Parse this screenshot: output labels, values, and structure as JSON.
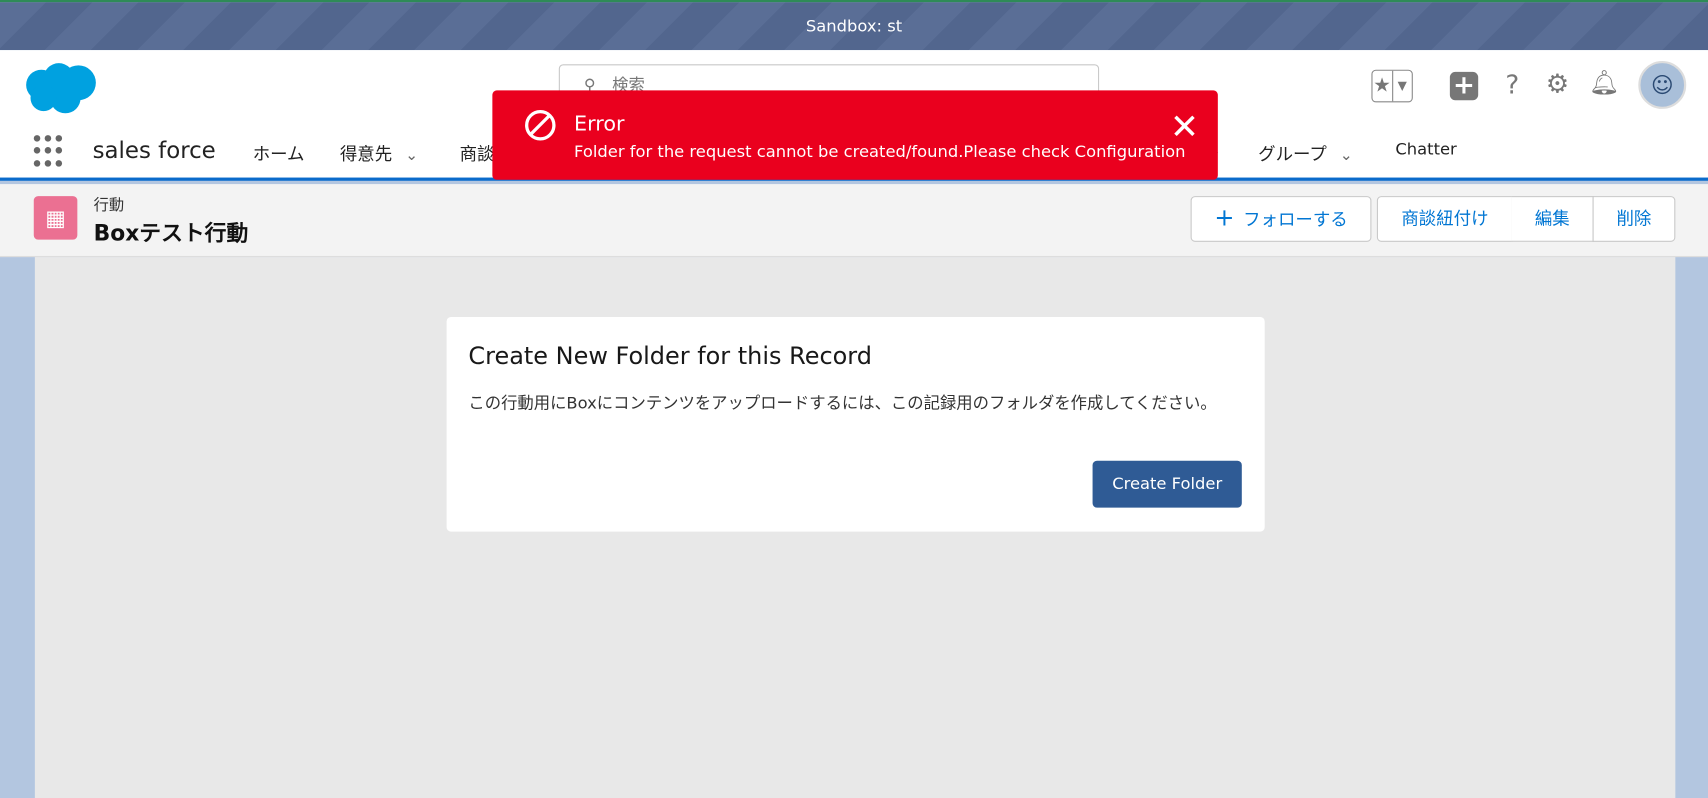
{
  "sandbox_banner": "Sandbox: st",
  "header": {
    "search_placeholder": "検索",
    "app_name": "sales force",
    "nav": [
      {
        "label": "ホーム"
      },
      {
        "label": "得意先"
      },
      {
        "label": "商談"
      },
      {
        "label": "グループ"
      },
      {
        "label": "Chatter"
      }
    ]
  },
  "toast": {
    "title": "Error",
    "message": "Folder for the request cannot be created/found.Please check Configuration",
    "color": "#ea001e"
  },
  "record": {
    "type": "行動",
    "title": "Boxテスト行動",
    "actions": {
      "follow": "フォローする",
      "link_deal": "商談紐付け",
      "edit": "編集",
      "delete": "削除"
    }
  },
  "card": {
    "title": "Create New Folder for this Record",
    "description": "この行動用にBoxにコンテンツをアップロードするには、この記録用のフォルダを作成してください。",
    "button": "Create Folder"
  }
}
